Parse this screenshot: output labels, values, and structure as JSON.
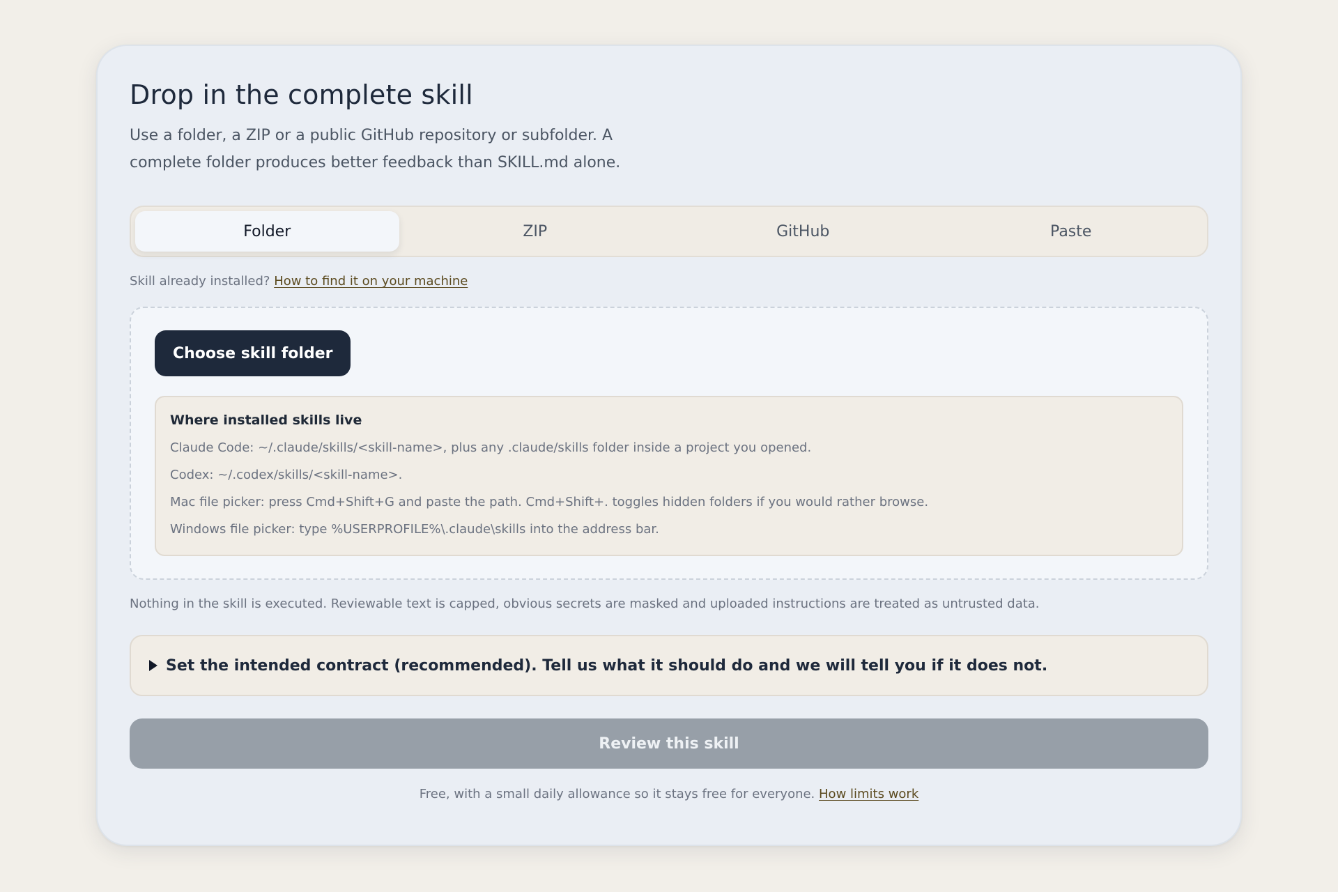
{
  "header": {
    "title": "Drop in the complete skill",
    "subtitle": "Use a folder, a ZIP or a public GitHub repository or subfolder. A complete folder produces better feedback than SKILL.md alone."
  },
  "tabs": [
    {
      "label": "Folder",
      "active": true
    },
    {
      "label": "ZIP",
      "active": false
    },
    {
      "label": "GitHub",
      "active": false
    },
    {
      "label": "Paste",
      "active": false
    }
  ],
  "installed_hint": {
    "text": "Skill already installed?",
    "link": "How to find it on your machine"
  },
  "dropzone": {
    "choose_button": "Choose skill folder",
    "where_box": {
      "title": "Where installed skills live",
      "lines": [
        "Claude Code: ~/.claude/skills/<skill-name>, plus any .claude/skills folder inside a project you opened.",
        "Codex: ~/.codex/skills/<skill-name>.",
        "Mac file picker: press Cmd+Shift+G and paste the path. Cmd+Shift+. toggles hidden folders if you would rather browse.",
        "Windows file picker: type %USERPROFILE%\\.claude\\skills into the address bar."
      ]
    }
  },
  "safety_note": "Nothing in the skill is executed. Reviewable text is capped, obvious secrets are masked and uploaded instructions are treated as untrusted data.",
  "contract": {
    "label": "Set the intended contract (recommended). Tell us what it should do and we will tell you if it does not."
  },
  "review_button": "Review this skill",
  "footer": {
    "text": "Free, with a small daily allowance so it stays free for everyone.",
    "link": "How limits work"
  },
  "colors": {
    "page_bg": "#f2efe9",
    "card_bg": "#eaeef4",
    "primary_button": "#1e293b",
    "disabled_button": "#979fa8",
    "link": "#5b4a1f"
  }
}
